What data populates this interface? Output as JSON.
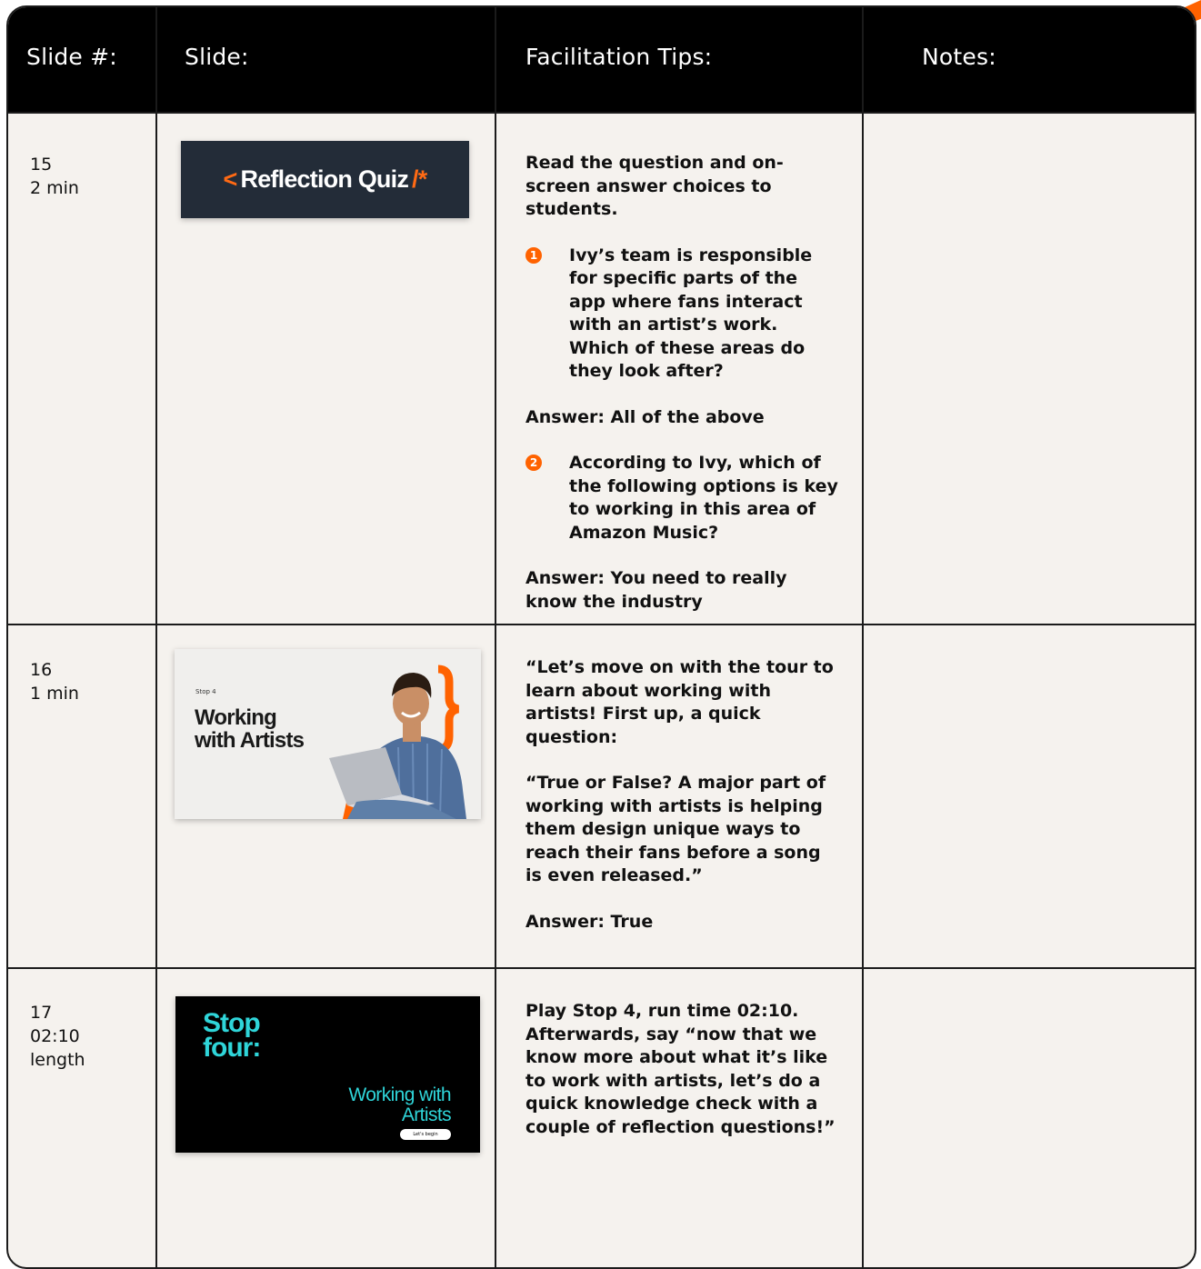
{
  "header": {
    "col1": "Slide #:",
    "col2": "Slide:",
    "col3": "Facilitation Tips:",
    "col4": "Notes:"
  },
  "rows": [
    {
      "number": "15",
      "duration": "2 min",
      "slide_title": "Reflection Quiz",
      "slide_prefix": "<",
      "slide_suffix": "/*",
      "intro": "Read the question and on-screen answer choices to students.",
      "q1_marker": "1",
      "q1": "Ivy’s team is responsible for specific parts of the app where fans interact with an artist’s work. Which of these areas do they look after?",
      "a1": "Answer: All of the above",
      "q2_marker": "2",
      "q2": "According to Ivy, which of the following options is key to working in this area of Amazon Music?",
      "a2": "Answer: You need to really know the industry"
    },
    {
      "number": "16",
      "duration": "1 min",
      "slide_kicker": "Stop 4",
      "slide_title_line1": "Working",
      "slide_title_line2": "with Artists",
      "p1": "“Let’s move on with the tour to learn about working with artists! First up, a quick question:",
      "p2": "“True or False? A major part of working with artists is helping them design unique ways to reach their fans before a song is even released.”",
      "p3": "Answer: True"
    },
    {
      "number": "17",
      "duration_line1": "02:10",
      "duration_line2": "length",
      "slide_title_line1": "Stop",
      "slide_title_line2": "four:",
      "slide_sub_line1": "Working with",
      "slide_sub_line2": "Artists",
      "slide_button": "Let's begin",
      "p1": "Play Stop 4, run time 02:10. Afterwards, say “now that we know more about what it’s like to work with artists, let’s do a quick knowledge check with a couple of reflection questions!”"
    }
  ],
  "colors": {
    "accent": "#ff6200",
    "header_bg": "#000000",
    "page_bg": "#f5f2ee",
    "teal": "#2fd5d9"
  }
}
